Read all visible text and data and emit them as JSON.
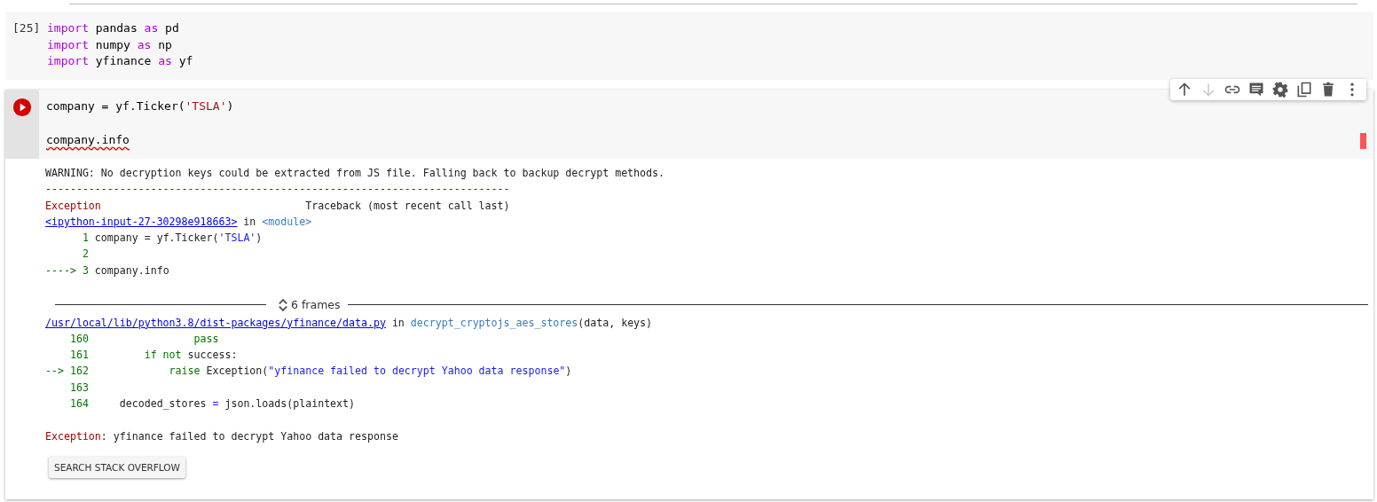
{
  "cells": [
    {
      "count": "[25]",
      "code": [
        [
          {
            "kind": "kw",
            "text": "import"
          },
          {
            "kind": "plain",
            "text": " pandas "
          },
          {
            "kind": "kw",
            "text": "as"
          },
          {
            "kind": "plain",
            "text": " pd"
          }
        ],
        [
          {
            "kind": "kw",
            "text": "import"
          },
          {
            "kind": "plain",
            "text": " numpy "
          },
          {
            "kind": "kw",
            "text": "as"
          },
          {
            "kind": "plain",
            "text": " np"
          }
        ],
        [
          {
            "kind": "kw",
            "text": "import"
          },
          {
            "kind": "plain",
            "text": " yfinance "
          },
          {
            "kind": "kw",
            "text": "as"
          },
          {
            "kind": "plain",
            "text": " yf"
          }
        ]
      ]
    },
    {
      "running": false,
      "toolbar": [
        {
          "kind": "up",
          "disabled": false
        },
        {
          "kind": "down",
          "disabled": true
        },
        {
          "kind": "link",
          "disabled": false
        },
        {
          "kind": "comment",
          "disabled": false
        },
        {
          "kind": "gear",
          "disabled": false
        },
        {
          "kind": "mirror",
          "disabled": false
        },
        {
          "kind": "trash",
          "disabled": false
        },
        {
          "kind": "more",
          "disabled": false
        }
      ],
      "code": [
        [
          {
            "kind": "plain",
            "text": "company = yf.Ticker("
          },
          {
            "kind": "str",
            "text": "'TSLA'"
          },
          {
            "kind": "plain",
            "text": ")"
          },
          {
            "kind": "blank_after"
          }
        ],
        [
          {
            "kind": "misspelled",
            "text": "company.info"
          }
        ]
      ],
      "output": {
        "lines_before": [
          [
            {
              "kind": "plain",
              "text": "WARNING: No decryption keys could be extracted from JS file. Falling back to backup decrypt methods."
            }
          ],
          [
            {
              "kind": "err",
              "text": "---------------------------------------------------------------------------"
            }
          ],
          [
            {
              "kind": "err",
              "text": "Exception"
            },
            {
              "kind": "plain",
              "text": "                                 Traceback (most recent call last)"
            }
          ],
          [
            {
              "kind": "link",
              "text": "<ipython-input-27-30298e918663>"
            },
            {
              "kind": "plain",
              "text": " in "
            },
            {
              "kind": "name",
              "text": "<module>"
            }
          ],
          [
            {
              "kind": "num",
              "text": "      1"
            },
            {
              "kind": "plain",
              "text": " company = yf.Ticker("
            },
            {
              "kind": "ostr",
              "text": "'TSLA'"
            },
            {
              "kind": "plain",
              "text": ")"
            }
          ],
          [
            {
              "kind": "num",
              "text": "      2"
            }
          ],
          [
            {
              "kind": "num",
              "text": "----> 3"
            },
            {
              "kind": "plain",
              "text": " company.info"
            },
            {
              "kind": "blank_after"
            }
          ]
        ],
        "frames_label": "6 frames",
        "lines_after": [
          [
            {
              "kind": "link",
              "text": "/usr/local/lib/python3.8/dist-packages/yfinance/data.py"
            },
            {
              "kind": "plain",
              "text": " in "
            },
            {
              "kind": "name",
              "text": "decrypt_cryptojs_aes_stores"
            },
            {
              "kind": "plain",
              "text": "(data, keys)"
            }
          ],
          [
            {
              "kind": "num",
              "text": "    160                 pass"
            }
          ],
          [
            {
              "kind": "num",
              "text": "    161         if not"
            },
            {
              "kind": "plain",
              "text": " success:"
            }
          ],
          [
            {
              "kind": "num",
              "text": "--> 162             raise"
            },
            {
              "kind": "plain",
              "text": " Exception("
            },
            {
              "kind": "ostr",
              "text": "\"yfinance failed to decrypt Yahoo data response\""
            },
            {
              "kind": "plain",
              "text": ")"
            }
          ],
          [
            {
              "kind": "num",
              "text": "    163"
            }
          ],
          [
            {
              "kind": "num",
              "text": "    164"
            },
            {
              "kind": "plain",
              "text": "     decoded_stores "
            },
            {
              "kind": "ostr",
              "text": "="
            },
            {
              "kind": "plain",
              "text": " json.loads(plaintext)"
            },
            {
              "kind": "blank_after"
            }
          ],
          [
            {
              "kind": "err",
              "text": "Exception"
            },
            {
              "kind": "plain",
              "text": ": yfinance failed to decrypt Yahoo data response"
            }
          ]
        ],
        "button": "SEARCH STACK OVERFLOW"
      }
    }
  ]
}
